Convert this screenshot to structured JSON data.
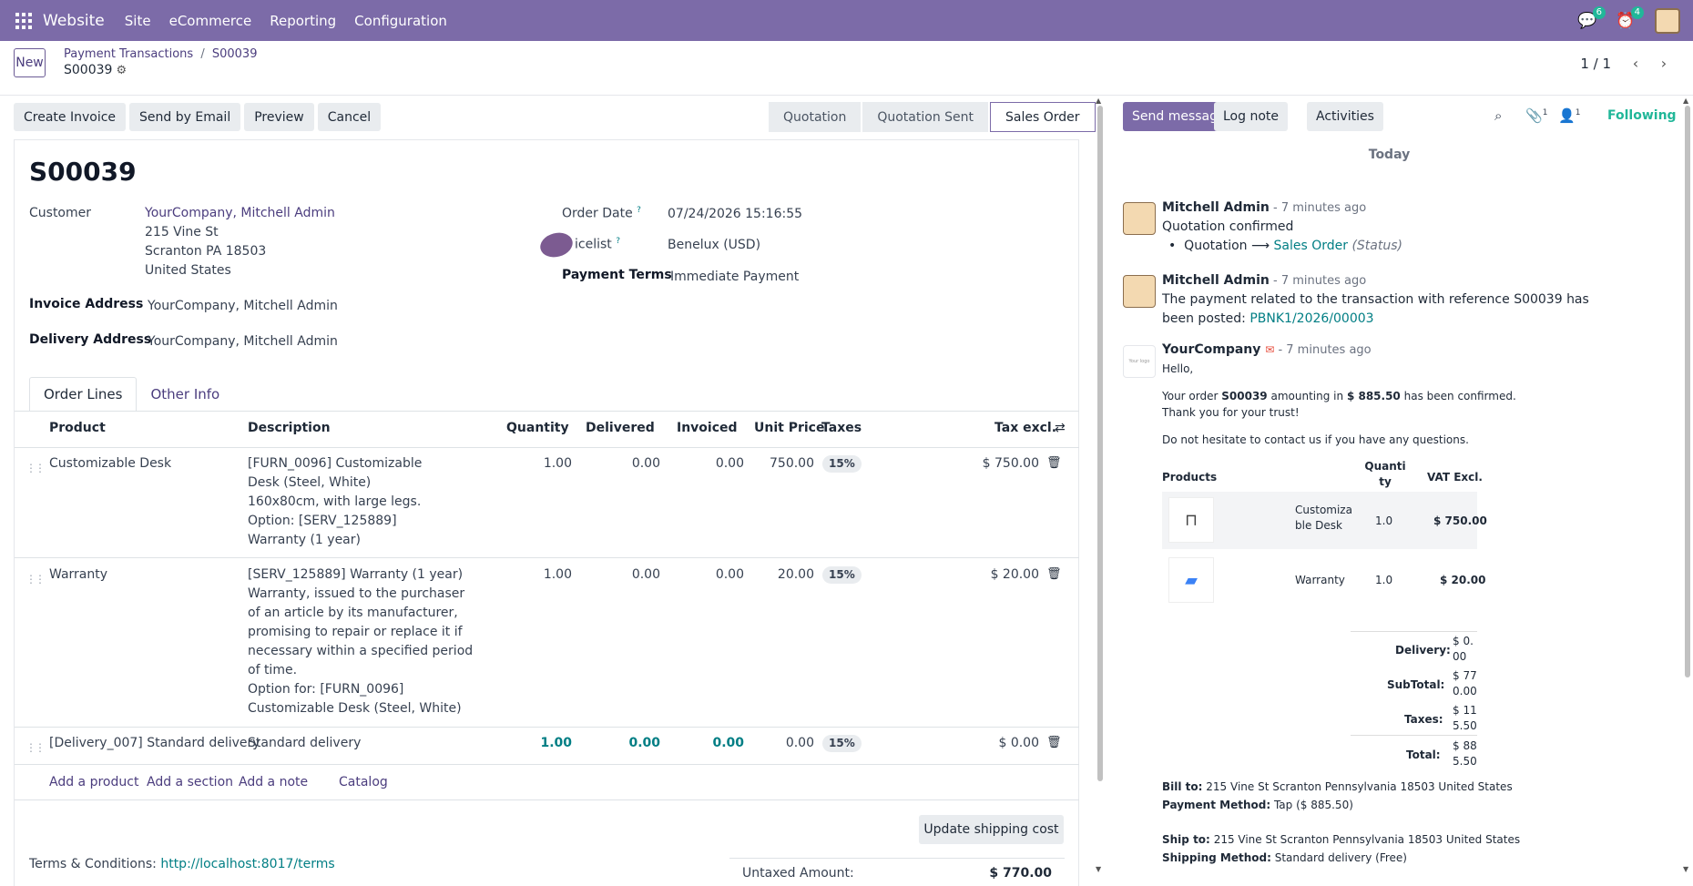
{
  "topbar": {
    "app": "Website",
    "menus": [
      "Site",
      "eCommerce",
      "Reporting",
      "Configuration"
    ],
    "msg_count": "6",
    "act_count": "4"
  },
  "control": {
    "new_label": "New",
    "breadcrumb_parent": "Payment Transactions",
    "breadcrumb_sep": "/",
    "breadcrumb_current": "S00039",
    "record_name": "S00039",
    "pager": "1 / 1"
  },
  "actions": {
    "create_invoice": "Create Invoice",
    "send_email": "Send by Email",
    "preview": "Preview",
    "cancel": "Cancel"
  },
  "status": [
    "Quotation",
    "Quotation Sent",
    "Sales Order"
  ],
  "form": {
    "title": "S00039",
    "customer_label": "Customer",
    "customer_name": "YourCompany, Mitchell Admin",
    "customer_addr1": "215 Vine St",
    "customer_addr2": "Scranton PA 18503",
    "customer_addr3": "United States",
    "invoice_label": "Invoice Address",
    "invoice_value": "YourCompany, Mitchell Admin",
    "delivery_label": "Delivery Address",
    "delivery_value": "YourCompany, Mitchell Admin",
    "order_date_label": "Order Date",
    "order_date": "07/24/2026 15:16:55",
    "pricelist_label": "icelist",
    "pricelist": "Benelux (USD)",
    "payment_terms_label": "Payment Terms",
    "payment_terms": "Immediate Payment"
  },
  "tabs": [
    "Order Lines",
    "Other Info"
  ],
  "table": {
    "headers": [
      "Product",
      "Description",
      "Quantity",
      "Delivered",
      "Invoiced",
      "Unit Price",
      "Taxes",
      "Tax excl."
    ],
    "rows": [
      {
        "product": "Customizable Desk",
        "desc": "[FURN_0096] Customizable Desk (Steel, White)\n160x80cm, with large legs.\nOption: [SERV_125889] Warranty (1 year)",
        "qty": "1.00",
        "delivered": "0.00",
        "invoiced": "0.00",
        "price": "750.00",
        "tax": "15%",
        "total": "$ 750.00"
      },
      {
        "product": "Warranty",
        "desc": "[SERV_125889] Warranty (1 year)\nWarranty, issued to the purchaser of an article by its manufacturer, promising to repair or replace it if necessary within a specified period of time.\nOption for: [FURN_0096] Customizable Desk (Steel, White)",
        "qty": "1.00",
        "delivered": "0.00",
        "invoiced": "0.00",
        "price": "20.00",
        "tax": "15%",
        "total": "$ 20.00"
      },
      {
        "product": "[Delivery_007] Standard delivery",
        "desc": "Standard delivery",
        "qty": "1.00",
        "delivered": "0.00",
        "invoiced": "0.00",
        "price": "0.00",
        "tax": "15%",
        "total": "$ 0.00"
      }
    ],
    "add_product": "Add a product",
    "add_section": "Add a section",
    "add_note": "Add a note",
    "catalog": "Catalog"
  },
  "update_shipping": "Update shipping cost",
  "terms_label": "Terms & Conditions:",
  "terms_link": "http://localhost:8017/terms",
  "untaxed_label": "Untaxed Amount:",
  "untaxed_value": "$ 770.00",
  "chatter": {
    "send_message": "Send message",
    "log_note": "Log note",
    "activities": "Activities",
    "attach_count": "1",
    "follower_count": "1",
    "following": "Following",
    "today": "Today",
    "m1": {
      "author": "Mitchell Admin",
      "time": " - 7 minutes ago",
      "body": "Quotation confirmed",
      "from": "Quotation",
      "arrow": "⟶",
      "to": "Sales Order",
      "field": "(Status)"
    },
    "m2": {
      "author": "Mitchell Admin",
      "time": " - 7 minutes ago",
      "body": "The payment related to the transaction with reference S00039 has been posted:",
      "link": "PBNK1/2026/00003"
    },
    "m3": {
      "author": "YourCompany",
      "time": " - 7 minutes ago",
      "logo_text": "Your logo",
      "hello": "Hello,",
      "order_pre": "Your order",
      "order_ref": "S00039",
      "order_mid": "amounting in",
      "order_amt": "$ 885.50",
      "order_post": "has been confirmed.",
      "thanks": "Thank you for your trust!",
      "contact": "Do not hesitate to contact us if you have any questions.",
      "th_products": "Products",
      "th_qty": "Quantity",
      "th_vat": "VAT Excl.",
      "p1_name": "Customizable Desk",
      "p1_qty": "1.0",
      "p1_vat": "$ 750.00",
      "p2_name": "Warranty",
      "p2_qty": "1.0",
      "p2_vat": "$ 20.00",
      "delivery_label": "Delivery:",
      "delivery_val": "$ 0.00",
      "subtotal_label": "SubTotal:",
      "subtotal_val": "$ 770.00",
      "taxes_label": "Taxes:",
      "taxes_val": "$ 115.50",
      "total_label": "Total:",
      "total_val": "$ 885.50",
      "bill_label": "Bill to:",
      "bill_val": "215 Vine St Scranton Pennsylvania 18503 United States",
      "pay_label": "Payment Method:",
      "pay_val": "Tap ($ 885.50)",
      "ship_label": "Ship to:",
      "ship_val": "215 Vine St Scranton Pennsylvania 18503 United States",
      "shipm_label": "Shipping Method:",
      "shipm_val": "Standard delivery (Free)"
    }
  }
}
